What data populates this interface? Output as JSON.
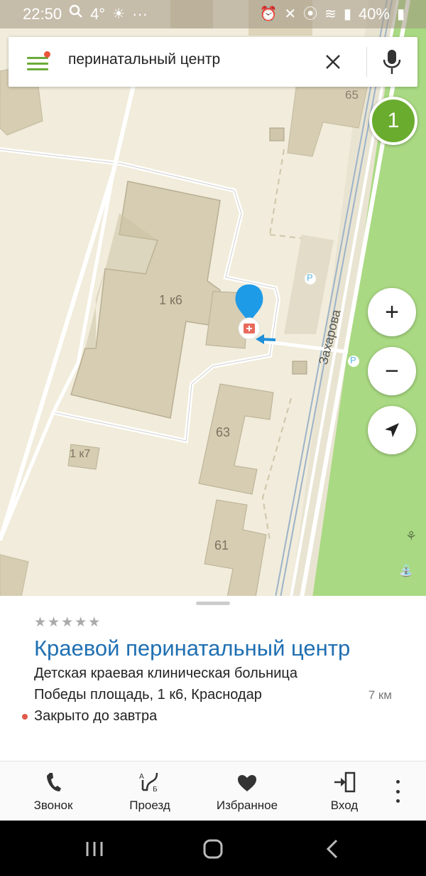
{
  "status_bar": {
    "time": "22:50",
    "temperature": "4°",
    "more_indicator": "···",
    "battery": "40%",
    "icons": [
      "search-icon",
      "weather-icon",
      "alarm-icon",
      "mute-icon",
      "location-icon",
      "wifi-icon",
      "signal-icon",
      "battery-icon"
    ]
  },
  "search": {
    "value": "перинатальный центр",
    "menu_icon": "hamburger-menu-icon",
    "clear_icon": "close-icon",
    "voice_icon": "microphone-icon"
  },
  "map": {
    "result_count": "1",
    "labels": {
      "house_65": "65",
      "building_main": "1 к6",
      "building_k7": "1 к7",
      "house_63": "63",
      "house_61": "61",
      "street": "Захарова",
      "parking": "P"
    },
    "controls": {
      "zoom_in": "+",
      "zoom_out": "−"
    },
    "colors": {
      "background": "#f1ecdb",
      "building": "#d6cdb2",
      "park": "#a9d982",
      "accent_green": "#6aac2d",
      "pin_blue": "#1e9be6"
    }
  },
  "place": {
    "rating": "★★★★★",
    "title": "Краевой перинатальный центр",
    "category": "Детская краевая клиническая больница",
    "address": "Победы площадь, 1 к6, Краснодар",
    "distance": "7 км",
    "status": "Закрыто до завтра"
  },
  "actions": [
    {
      "label": "Звонок",
      "icon": "phone-icon"
    },
    {
      "label": "Проезд",
      "icon": "route-icon"
    },
    {
      "label": "Избранное",
      "icon": "heart-icon"
    },
    {
      "label": "Вход",
      "icon": "entrance-icon"
    }
  ],
  "system_nav": {
    "recents_icon": "recents-icon",
    "home_icon": "home-icon",
    "back_icon": "back-icon"
  }
}
